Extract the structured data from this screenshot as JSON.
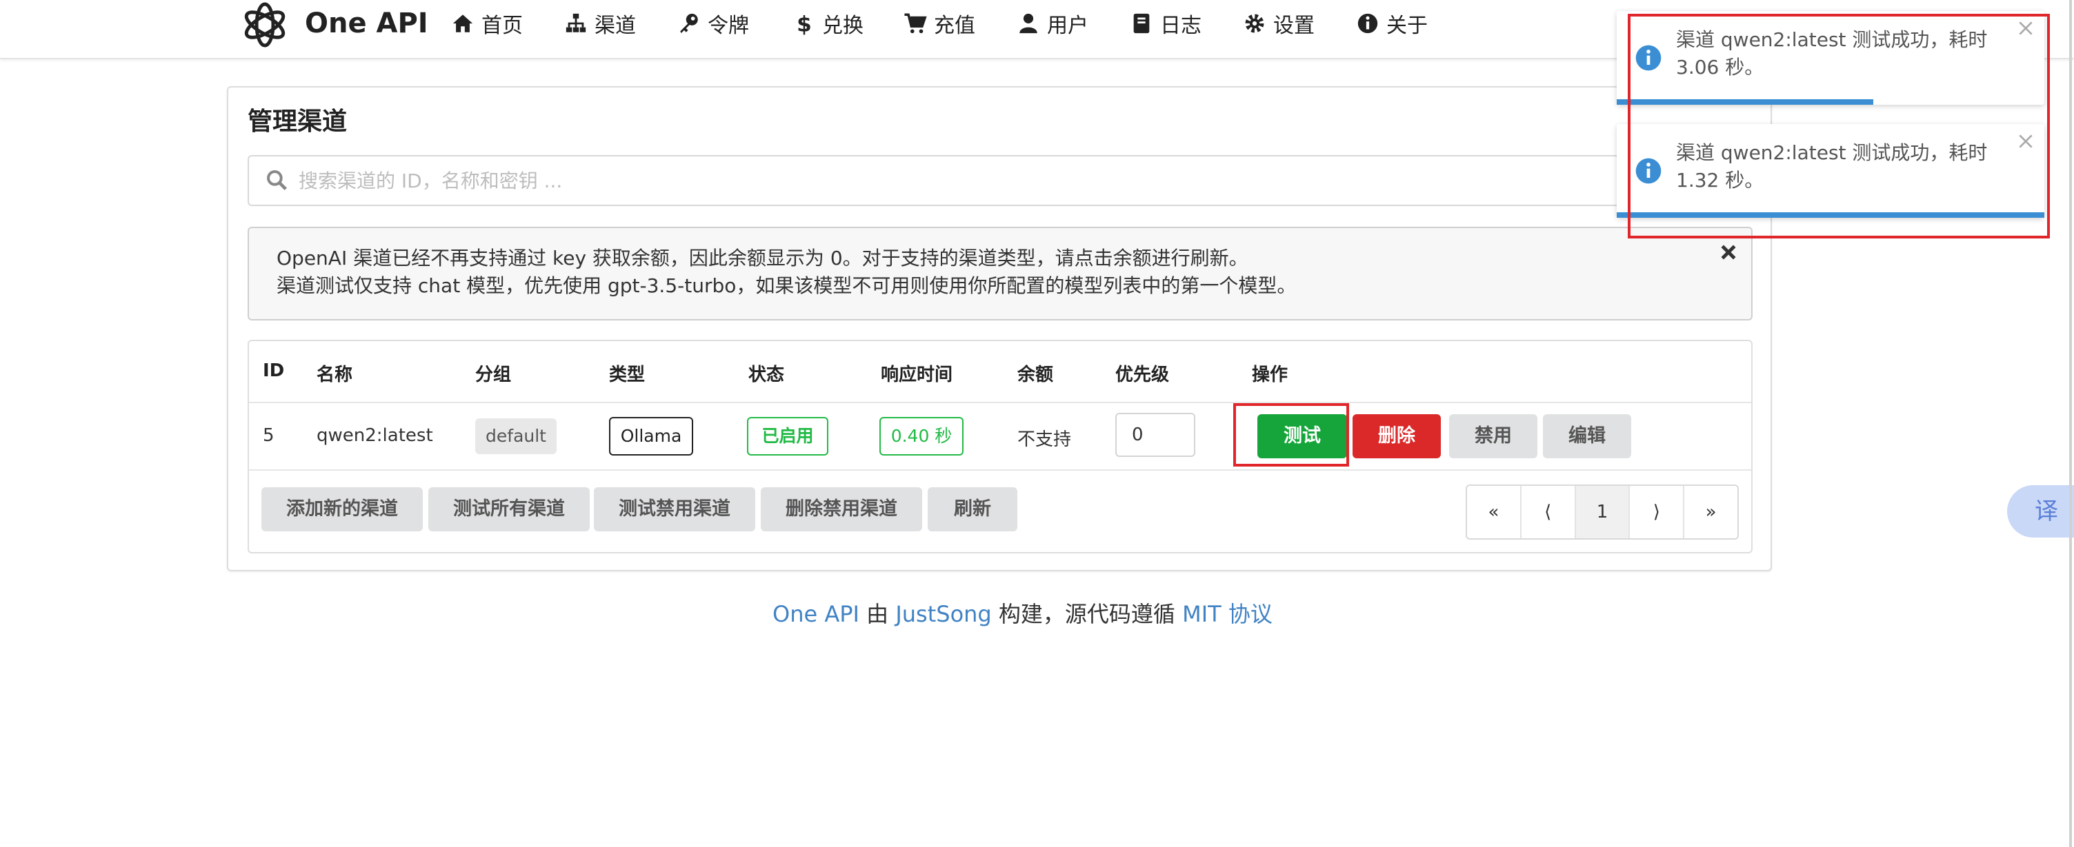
{
  "app": {
    "brand": "One API"
  },
  "nav": [
    {
      "label": "首页",
      "icon": "home-icon"
    },
    {
      "label": "渠道",
      "icon": "sitemap-icon"
    },
    {
      "label": "令牌",
      "icon": "key-icon"
    },
    {
      "label": "兑换",
      "icon": "dollar-icon"
    },
    {
      "label": "充值",
      "icon": "cart-icon"
    },
    {
      "label": "用户",
      "icon": "user-icon"
    },
    {
      "label": "日志",
      "icon": "book-icon"
    },
    {
      "label": "设置",
      "icon": "gear-icon"
    },
    {
      "label": "关于",
      "icon": "info-icon"
    }
  ],
  "page": {
    "title": "管理渠道",
    "search_placeholder": "搜索渠道的 ID，名称和密钥 ...",
    "notice": [
      "OpenAI 渠道已经不再支持通过 key 获取余额，因此余额显示为 0。对于支持的渠道类型，请点击余额进行刷新。",
      "渠道测试仅支持 chat 模型，优先使用 gpt-3.5-turbo，如果该模型不可用则使用你所配置的模型列表中的第一个模型。"
    ]
  },
  "table": {
    "headers": [
      "ID",
      "名称",
      "分组",
      "类型",
      "状态",
      "响应时间",
      "余额",
      "优先级",
      "操作"
    ],
    "rows": [
      {
        "id": "5",
        "name": "qwen2:latest",
        "group": "default",
        "type": "Ollama",
        "status": "已启用",
        "response_time": "0.40 秒",
        "balance": "不支持",
        "priority": "0",
        "actions": {
          "test": "测试",
          "delete": "删除",
          "disable": "禁用",
          "edit": "编辑"
        }
      }
    ]
  },
  "bottom_buttons": {
    "add": "添加新的渠道",
    "test_all": "测试所有渠道",
    "test_disabled": "测试禁用渠道",
    "delete_disabled": "删除禁用渠道",
    "refresh": "刷新"
  },
  "pagination": {
    "first": "«",
    "prev": "⟨",
    "current": "1",
    "next": "⟩",
    "last": "»"
  },
  "footer": {
    "brand_link": "One API",
    "by": "由",
    "author_link": "JustSong",
    "built": "构建，源代码遵循",
    "license_link": "MIT 协议"
  },
  "toasts": [
    {
      "message": "渠道 qwen2:latest 测试成功，耗时 3.06 秒。",
      "progress": 0.6
    },
    {
      "message": "渠道 qwen2:latest 测试成功，耗时 1.32 秒。",
      "progress": 1.0
    }
  ],
  "translate": {
    "label": "译"
  },
  "colors": {
    "accent_blue": "#4183c4",
    "success_green": "#21ba45",
    "danger_red": "#db2828",
    "highlight_red": "#e0262a",
    "toast_blue": "#3c8ed4"
  }
}
